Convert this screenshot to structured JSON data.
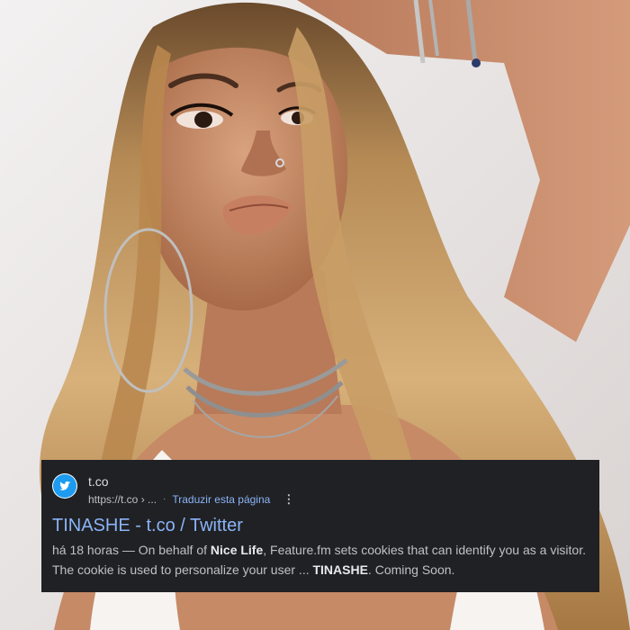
{
  "result": {
    "site_name": "t.co",
    "url_text": "https://t.co › ...",
    "separator": "·",
    "translate_label": "Traduzir esta página",
    "more_icon": "⋮",
    "favicon_icon": "twitter-bird-icon",
    "title": "TINASHE - t.co / Twitter",
    "snippet": {
      "date": "há 18 horas",
      "dash": " — On behalf of ",
      "bold1": "Nice Life",
      "mid": ", Feature.fm sets cookies that can identify you as a visitor. The cookie is used to personalize your user ... ",
      "bold2": "TINASHE",
      "end": ". Coming Soon."
    }
  },
  "colors": {
    "card_bg": "#202124",
    "link_blue": "#8ab4f8",
    "text_gray": "#bdc1c6",
    "twitter_blue": "#1d9bf0"
  }
}
